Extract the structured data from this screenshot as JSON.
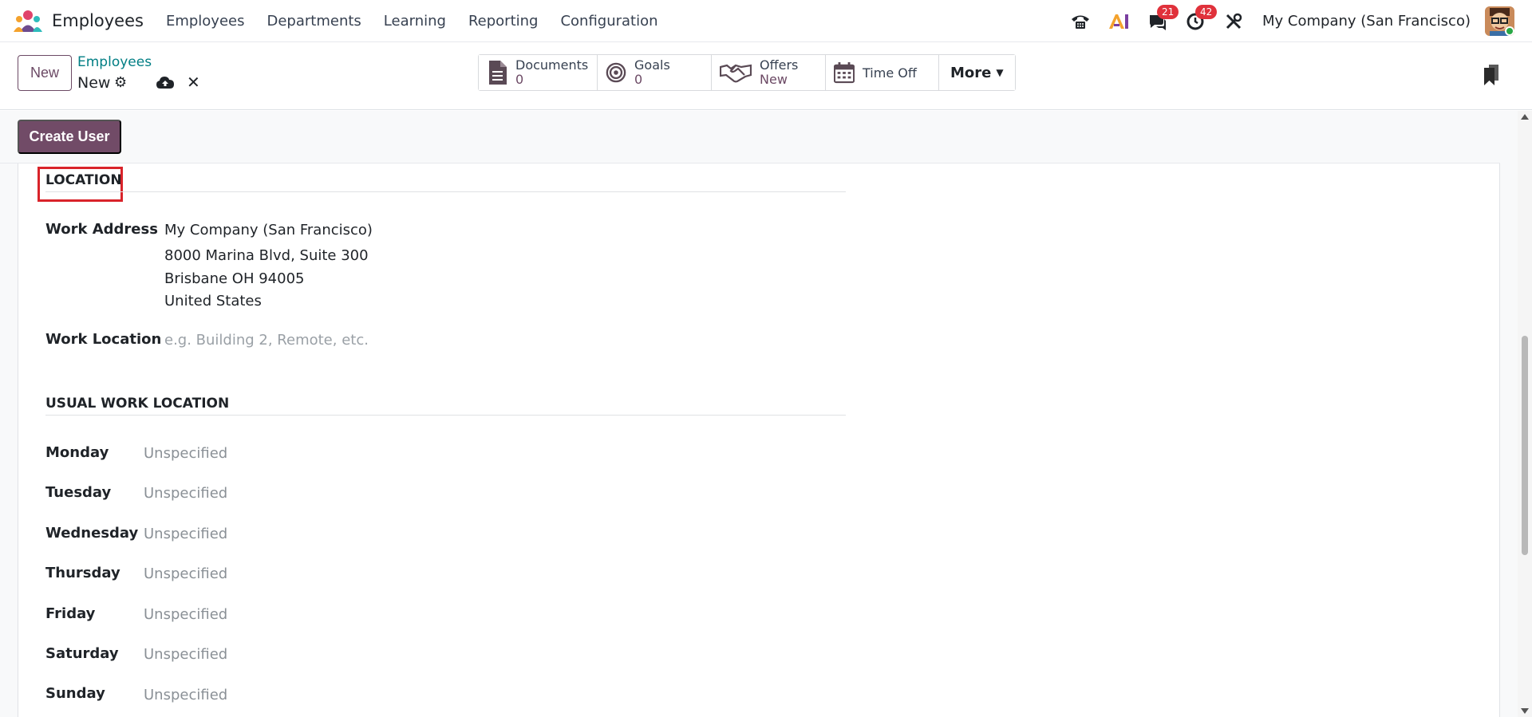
{
  "app": {
    "name": "Employees",
    "menu": [
      "Employees",
      "Departments",
      "Learning",
      "Reporting",
      "Configuration"
    ],
    "company": "My Company (San Francisco)",
    "badges": {
      "messages": "21",
      "activities": "42"
    },
    "icons": [
      "phone-icon",
      "ai-icon",
      "chat-icon",
      "clock-icon",
      "tools-icon"
    ]
  },
  "control": {
    "new_label": "New",
    "breadcrumb_parent": "Employees",
    "breadcrumb_current": "New",
    "smart_buttons": [
      {
        "label": "Documents",
        "value": "0",
        "icon": "document-icon"
      },
      {
        "label": "Goals",
        "value": "0",
        "icon": "target-icon"
      },
      {
        "label": "Offers",
        "value": "New",
        "icon": "handshake-icon"
      },
      {
        "label": "Time Off",
        "icon": "calendar-icon"
      }
    ],
    "more_label": "More"
  },
  "status": {
    "create_user_label": "Create User"
  },
  "location": {
    "title": "LOCATION",
    "work_address_label": "Work Address",
    "work_address_lines": [
      "My Company (San Francisco)",
      "8000 Marina Blvd, Suite 300",
      "Brisbane OH 94005",
      "United States"
    ],
    "work_location_label": "Work Location",
    "work_location_placeholder": "e.g. Building 2, Remote, etc."
  },
  "usual": {
    "title": "USUAL WORK LOCATION",
    "days": [
      {
        "day": "Monday",
        "value": "Unspecified"
      },
      {
        "day": "Tuesday",
        "value": "Unspecified"
      },
      {
        "day": "Wednesday",
        "value": "Unspecified"
      },
      {
        "day": "Thursday",
        "value": "Unspecified"
      },
      {
        "day": "Friday",
        "value": "Unspecified"
      },
      {
        "day": "Saturday",
        "value": "Unspecified"
      },
      {
        "day": "Sunday",
        "value": "Unspecified"
      }
    ]
  },
  "colors": {
    "primary": "#714b67",
    "link": "#017e84",
    "badge": "#e0313b",
    "highlight": "#d9232a"
  }
}
